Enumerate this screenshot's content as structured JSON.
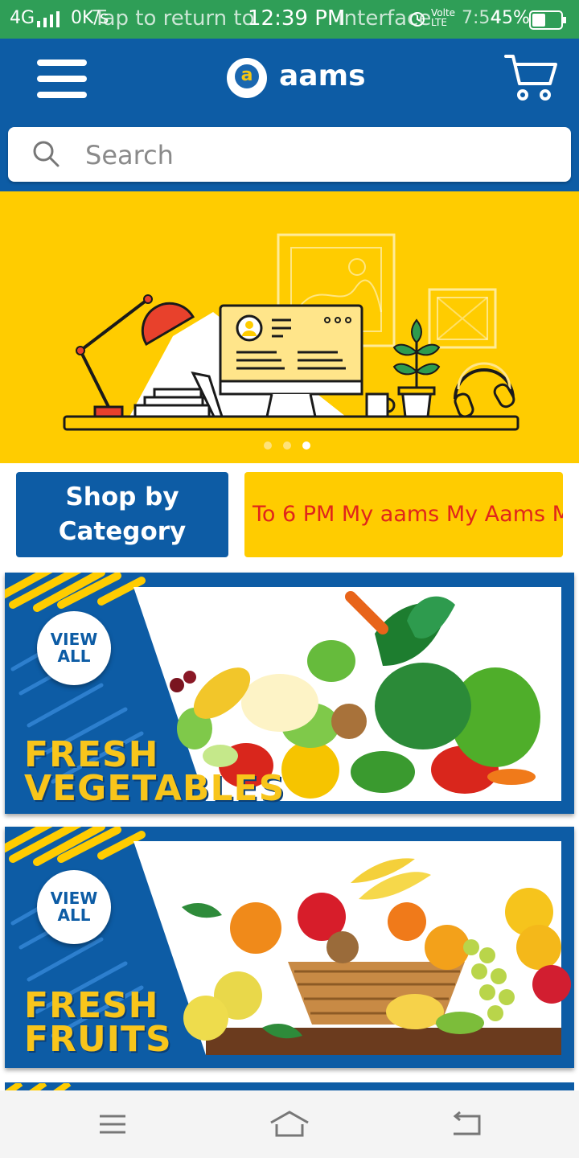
{
  "status_bar": {
    "network": "4G",
    "speed": "0K/s",
    "overlay_text": "Tap to return to",
    "time": "12:39 PM",
    "overlay_text2": "Interface",
    "carrier": "Volte LTE",
    "overlay_time": "7:54",
    "battery": "45%",
    "bg_color": "#2f9e57"
  },
  "header": {
    "title": "aams",
    "logo_letter": "a",
    "menu_icon": "hamburger-icon",
    "cart_icon": "shopping-cart-icon",
    "bg_color": "#0d5ca5"
  },
  "search": {
    "placeholder": "Search",
    "icon": "search-icon"
  },
  "hero": {
    "bg_color": "#ffcc00",
    "slide_count": 3,
    "active_slide": 3
  },
  "quick_actions": {
    "shop_by_category_line1": "Shop by",
    "shop_by_category_line2": "Category",
    "ticker_text": "To 6 PM My aams My Aams M"
  },
  "banners": [
    {
      "cta_line1": "VIEW",
      "cta_line2": "ALL",
      "title_line1": "FRESH",
      "title_line2": "VEGETABLES"
    },
    {
      "cta_line1": "VIEW",
      "cta_line2": "ALL",
      "title_line1": "FRESH",
      "title_line2": "FRUITS"
    }
  ],
  "nav_bar": {
    "menu_icon": "recents-icon",
    "home_icon": "home-icon",
    "back_icon": "back-icon"
  }
}
